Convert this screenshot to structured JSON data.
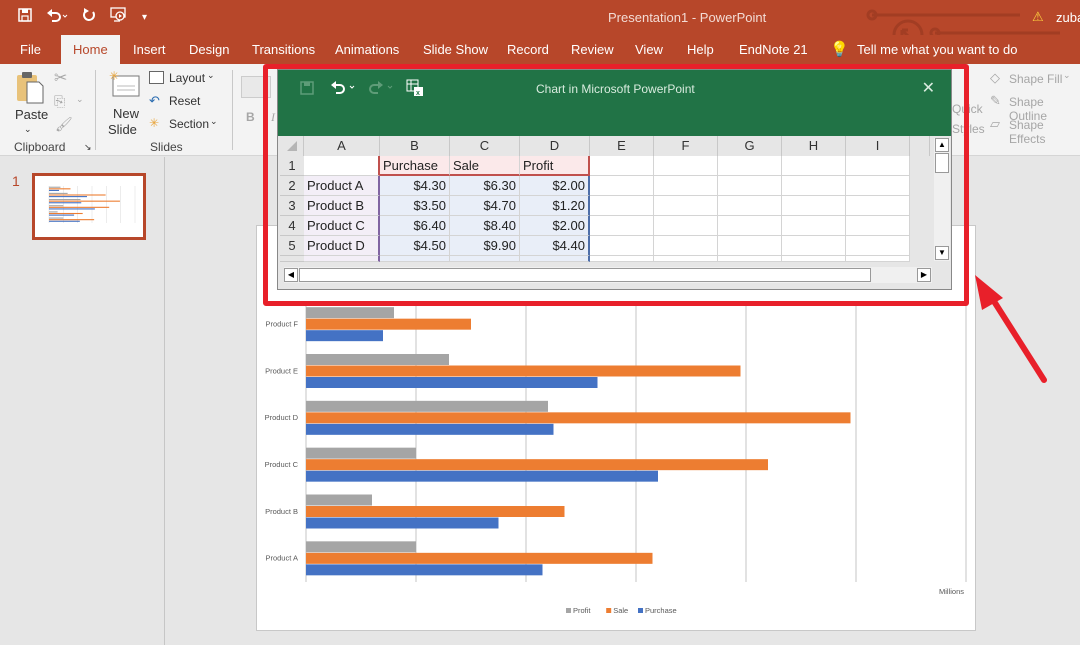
{
  "window": {
    "title": "Presentation1  -  PowerPoint",
    "user": "zuba",
    "warning_icon": "warning-icon"
  },
  "qat": {
    "icons": [
      "save-icon",
      "undo-icon",
      "redo-icon",
      "start-from-beginning-icon",
      "customize-qat-icon"
    ]
  },
  "tabs": [
    {
      "label": "File"
    },
    {
      "label": "Home",
      "active": true
    },
    {
      "label": "Insert"
    },
    {
      "label": "Design"
    },
    {
      "label": "Transitions"
    },
    {
      "label": "Animations"
    },
    {
      "label": "Slide Show"
    },
    {
      "label": "Record"
    },
    {
      "label": "Review"
    },
    {
      "label": "View"
    },
    {
      "label": "Help"
    },
    {
      "label": "EndNote 21"
    }
  ],
  "tell_me": "Tell me what you want to do",
  "ribbon": {
    "clipboard": {
      "paste": "Paste",
      "group": "Clipboard"
    },
    "slides": {
      "new_slide_1": "New",
      "new_slide_2": "Slide",
      "layout": "Layout",
      "reset": "Reset",
      "section": "Section",
      "group": "Slides"
    },
    "font": {
      "bold": "B",
      "italic": "I"
    },
    "drawing": {
      "quick_styles_1": "Quick",
      "quick_styles_2": "Styles",
      "shape_fill": "Shape Fill",
      "shape_outline": "Shape Outline",
      "shape_effects": "Shape Effects"
    }
  },
  "thumbnails": {
    "slide_number": "1"
  },
  "excel": {
    "title": "Chart in Microsoft PowerPoint",
    "columns": [
      "A",
      "B",
      "C",
      "D",
      "E",
      "F",
      "G",
      "H",
      "I"
    ],
    "rows": [
      {
        "n": "1",
        "cells": [
          "",
          "Purchase",
          "Sale",
          "Profit"
        ]
      },
      {
        "n": "2",
        "cells": [
          "Product A",
          "$4.30",
          "$6.30",
          "$2.00"
        ]
      },
      {
        "n": "3",
        "cells": [
          "Product B",
          "$3.50",
          "$4.70",
          "$1.20"
        ]
      },
      {
        "n": "4",
        "cells": [
          "Product C",
          "$6.40",
          "$8.40",
          "$2.00"
        ]
      },
      {
        "n": "5",
        "cells": [
          "Product D",
          "$4.50",
          "$9.90",
          "$4.40"
        ]
      }
    ]
  },
  "colors": {
    "accent": "#b7472a",
    "excel_green": "#217346",
    "highlight_red": "#e8202a",
    "purchase": "#4472c4",
    "sale": "#ed7d31",
    "profit": "#a5a5a5"
  },
  "chart_data": {
    "type": "bar",
    "orientation": "horizontal",
    "categories": [
      "Product A",
      "Product B",
      "Product C",
      "Product D",
      "Product E",
      "Product F"
    ],
    "series": [
      {
        "name": "Purchase",
        "values": [
          4.3,
          3.5,
          6.4,
          4.5,
          5.3,
          1.4
        ]
      },
      {
        "name": "Sale",
        "values": [
          6.3,
          4.7,
          8.4,
          9.9,
          7.9,
          3.0
        ]
      },
      {
        "name": "Profit",
        "values": [
          2.0,
          1.2,
          2.0,
          4.4,
          2.6,
          1.6
        ]
      }
    ],
    "xlim": [
      0,
      12
    ],
    "x_gridlines_every": 2,
    "x_unit_label": "Millions",
    "legend": [
      "Profit",
      "Sale",
      "Purchase"
    ],
    "legend_position": "bottom",
    "grid": true
  }
}
